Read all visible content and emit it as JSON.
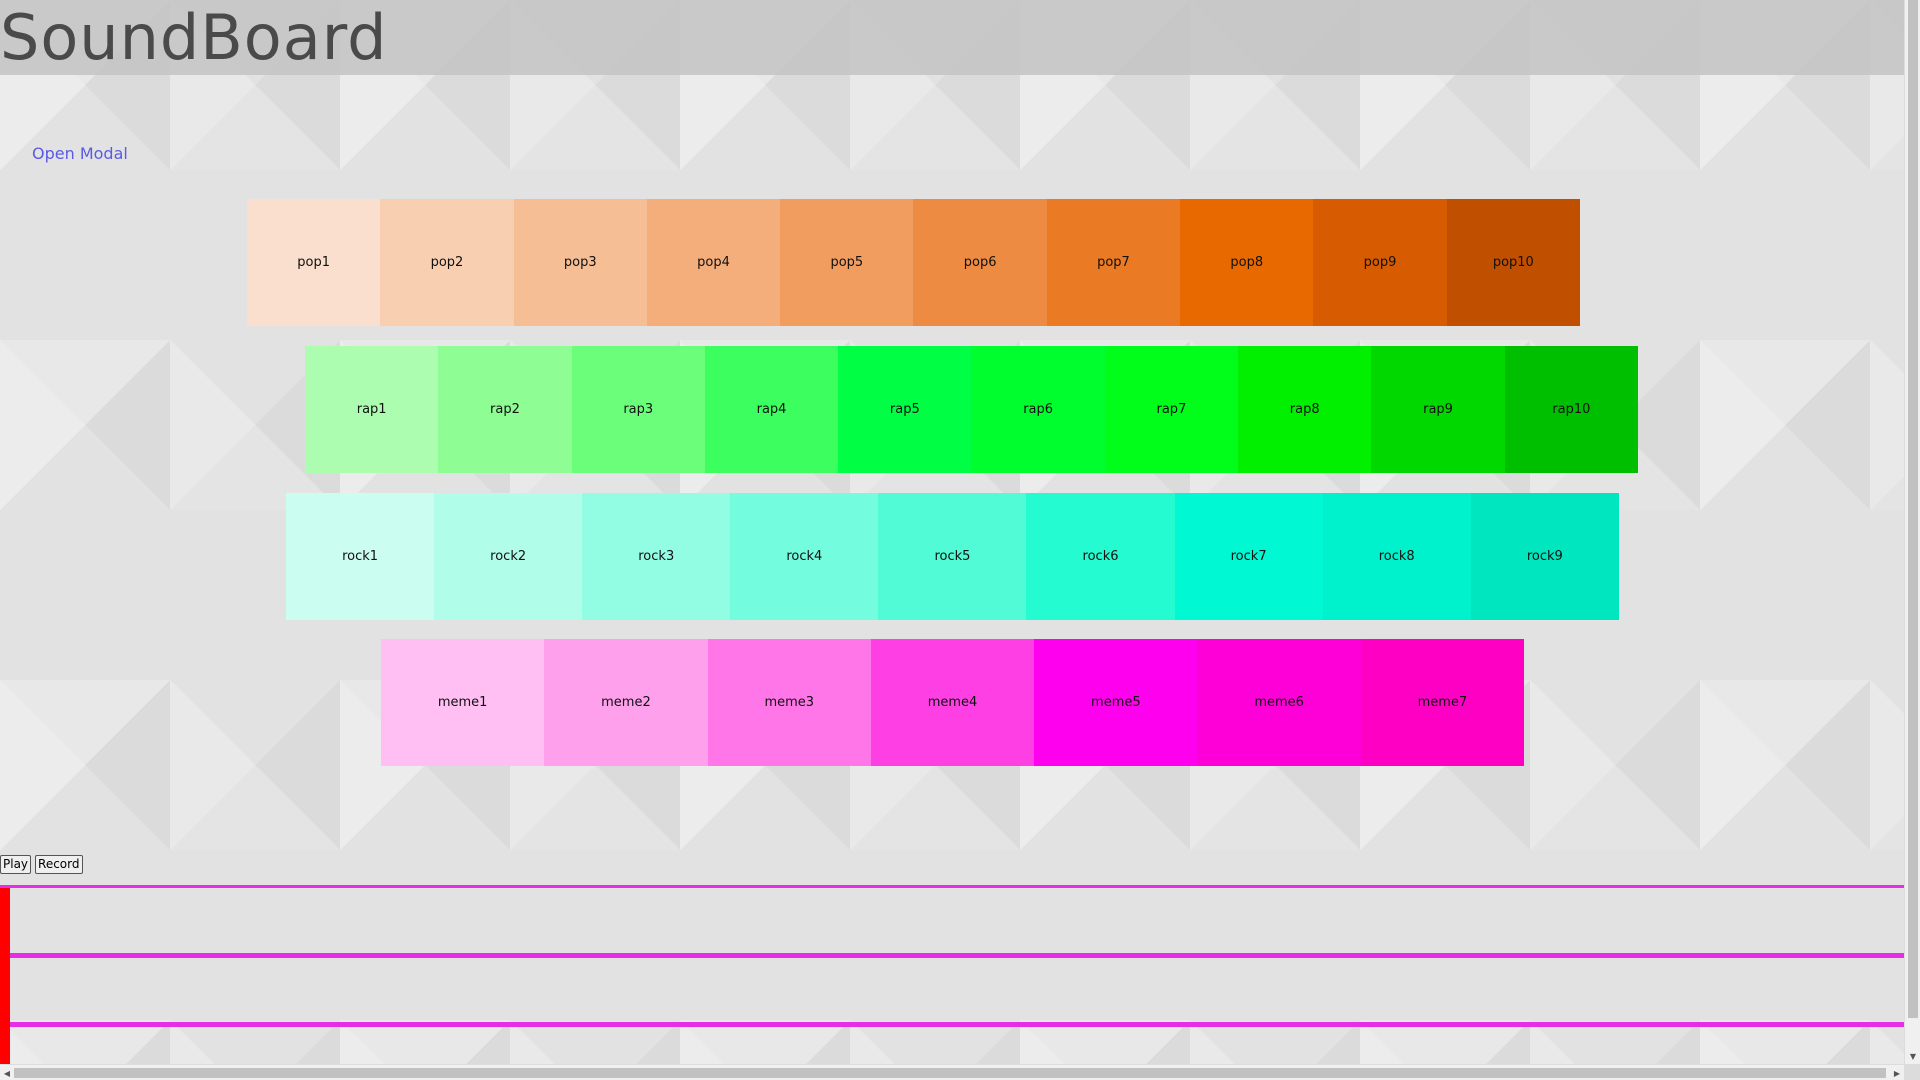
{
  "header": {
    "title": "SoundBoard"
  },
  "links": {
    "open_modal": "Open Modal"
  },
  "pads": {
    "pop": [
      {
        "label": "pop1",
        "color": "#fadfce"
      },
      {
        "label": "pop2",
        "color": "#f9cfb1"
      },
      {
        "label": "pop3",
        "color": "#f6be94"
      },
      {
        "label": "pop4",
        "color": "#f4ae7c"
      },
      {
        "label": "pop5",
        "color": "#f19d60"
      },
      {
        "label": "pop6",
        "color": "#ee8b43"
      },
      {
        "label": "pop7",
        "color": "#eb7a24"
      },
      {
        "label": "pop8",
        "color": "#e96901"
      },
      {
        "label": "pop9",
        "color": "#d75b00"
      },
      {
        "label": "pop10",
        "color": "#c14f00"
      }
    ],
    "rap": [
      {
        "label": "rap1",
        "color": "#adfdb0"
      },
      {
        "label": "rap2",
        "color": "#8dfd94"
      },
      {
        "label": "rap3",
        "color": "#6afe7b"
      },
      {
        "label": "rap4",
        "color": "#3cfe5f"
      },
      {
        "label": "rap5",
        "color": "#00fe45"
      },
      {
        "label": "rap6",
        "color": "#00fe2f"
      },
      {
        "label": "rap7",
        "color": "#00fe1a"
      },
      {
        "label": "rap8",
        "color": "#00f000"
      },
      {
        "label": "rap9",
        "color": "#00d800"
      },
      {
        "label": "rap10",
        "color": "#00bf00"
      }
    ],
    "rock": [
      {
        "label": "rock1",
        "color": "#ccfdf1"
      },
      {
        "label": "rock2",
        "color": "#b0fdea"
      },
      {
        "label": "rock3",
        "color": "#93fde4"
      },
      {
        "label": "rock4",
        "color": "#73fcdd"
      },
      {
        "label": "rock5",
        "color": "#50fbd6"
      },
      {
        "label": "rock6",
        "color": "#24fbd1"
      },
      {
        "label": "rock7",
        "color": "#00f8d2"
      },
      {
        "label": "rock8",
        "color": "#00f2cc"
      },
      {
        "label": "rock9",
        "color": "#00e6bf"
      }
    ],
    "meme": [
      {
        "label": "meme1",
        "color": "#ffbff3"
      },
      {
        "label": "meme2",
        "color": "#ffa0ed"
      },
      {
        "label": "meme3",
        "color": "#ff76e8"
      },
      {
        "label": "meme4",
        "color": "#fe3fe3"
      },
      {
        "label": "meme5",
        "color": "#fe00ee"
      },
      {
        "label": "meme6",
        "color": "#fe00d7"
      },
      {
        "label": "meme7",
        "color": "#fe00c4"
      }
    ]
  },
  "controls": {
    "play_label": "Play",
    "record_label": "Record"
  },
  "colors": {
    "track_line": "#e62ee6",
    "playhead": "#ff0000",
    "link": "#5a5ae6"
  }
}
